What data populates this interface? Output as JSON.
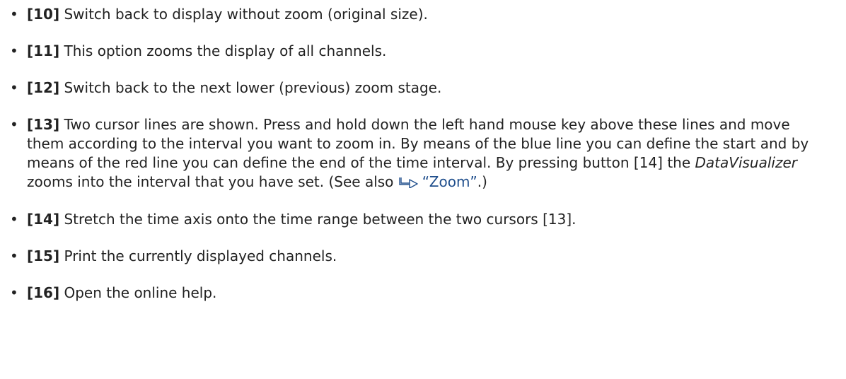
{
  "items": [
    {
      "num": "[10]",
      "text": "Switch back to display without zoom (original size)."
    },
    {
      "num": "[11]",
      "text": "This option zooms the display of all channels."
    },
    {
      "num": "[12]",
      "text": "Switch back to the next lower (previous) zoom stage."
    },
    {
      "num": "[13]",
      "text_before": "Two cursor lines are shown. Press and hold down the left hand mouse key above these lines and move them according to the interval you want to zoom in. By means of the blue line you can define the start and by means of the red line you can define the end of the time interval. By pressing button [14] the ",
      "emph": "DataVisualizer",
      "text_mid": " zooms into the interval that you have set. (See also ",
      "link": "“Zoom”",
      "text_after": ".)",
      "link_icon": "cross-reference-arrow-icon"
    },
    {
      "num": "[14]",
      "text": "Stretch the time axis onto the time range between the two cursors [13]."
    },
    {
      "num": "[15]",
      "text": "Print the currently displayed channels."
    },
    {
      "num": "[16]",
      "text": "Open the online help."
    }
  ],
  "colors": {
    "text": "#222222",
    "link": "#1f4e8c"
  }
}
